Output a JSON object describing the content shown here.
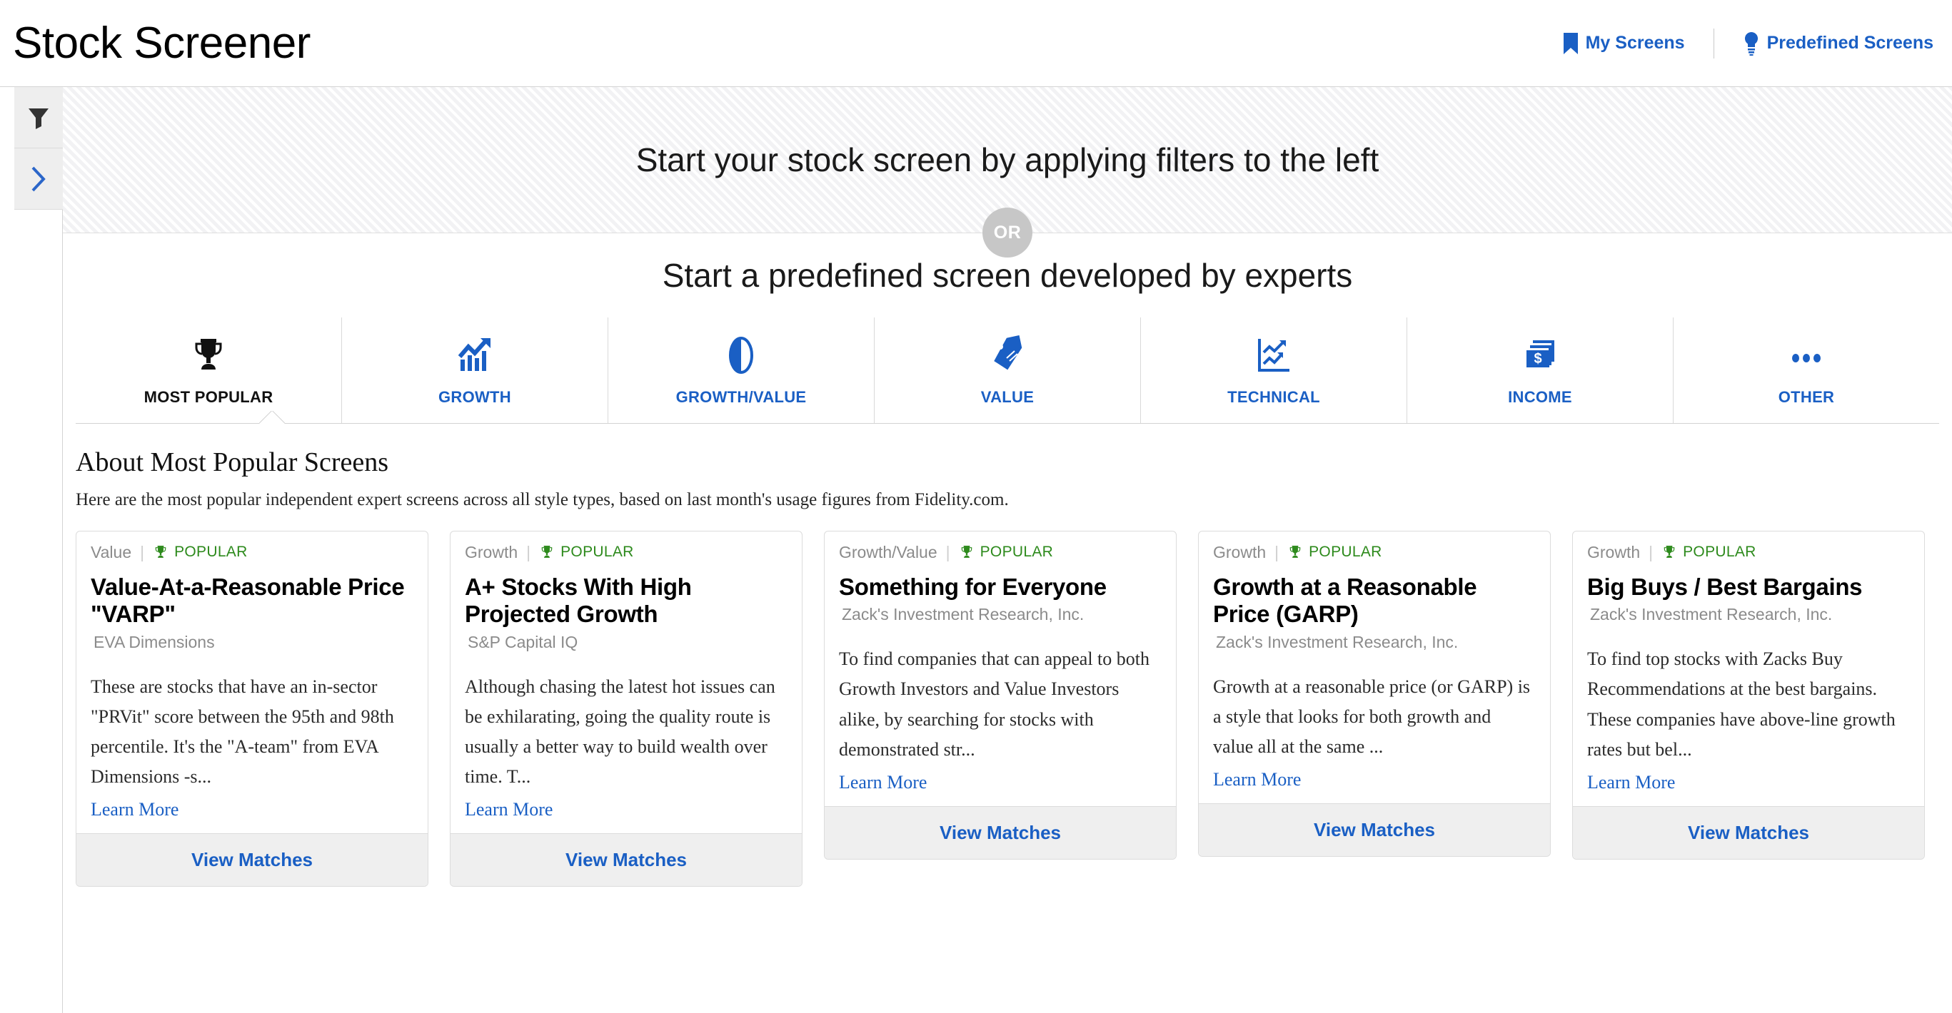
{
  "header": {
    "title": "Stock Screener",
    "links": [
      {
        "label": "My Screens",
        "icon": "bookmark-icon"
      },
      {
        "label": "Predefined Screens",
        "icon": "lightbulb-icon"
      }
    ]
  },
  "left_rail": {
    "buttons": [
      {
        "icon": "filter-funnel-icon"
      },
      {
        "icon": "chevron-right-icon"
      }
    ]
  },
  "hero": {
    "line1": "Start your stock screen by applying filters to the left",
    "or_badge": "OR",
    "line2": "Start a predefined screen developed by experts"
  },
  "tabs": [
    {
      "label": "MOST POPULAR",
      "icon": "trophy-icon",
      "active": true
    },
    {
      "label": "GROWTH",
      "icon": "growth-chart-arrow-icon",
      "active": false
    },
    {
      "label": "GROWTH/VALUE",
      "icon": "half-filled-circle-icon",
      "active": false
    },
    {
      "label": "VALUE",
      "icon": "price-tag-icon",
      "active": false
    },
    {
      "label": "TECHNICAL",
      "icon": "technical-chart-icon",
      "active": false
    },
    {
      "label": "INCOME",
      "icon": "money-stack-icon",
      "active": false
    },
    {
      "label": "OTHER",
      "icon": "ellipsis-icon",
      "active": false
    }
  ],
  "about": {
    "title": "About Most Popular Screens",
    "description": "Here are the most popular independent expert screens across all style types, based on last month's usage figures from Fidelity.com."
  },
  "colors": {
    "link_blue": "#1a5fc4",
    "popular_green": "#2d8a1c",
    "meta_gray": "#8b8b8b",
    "footer_gray": "#efefef"
  },
  "cards": [
    {
      "style": "Value",
      "badge": "POPULAR",
      "badge_icon": "trophy-icon",
      "title": "Value-At-a-Reasonable Price \"VARP\"",
      "provider": "EVA Dimensions",
      "description": "These are stocks that have an in-sector \"PRVit\" score between the 95th and 98th percentile. It's the \"A-team\" from EVA Dimensions -s...",
      "learn_more": "Learn More",
      "action": "View Matches"
    },
    {
      "style": "Growth",
      "badge": "POPULAR",
      "badge_icon": "trophy-icon",
      "title": "A+ Stocks With High Projected Growth",
      "provider": "S&P Capital IQ",
      "description": "Although chasing the latest hot issues can be exhilarating, going the quality route is usually a better way to build wealth over time. T...",
      "learn_more": "Learn More",
      "action": "View Matches"
    },
    {
      "style": "Growth/Value",
      "badge": "POPULAR",
      "badge_icon": "trophy-icon",
      "title": "Something for Everyone",
      "provider": "Zack's Investment Research, Inc.",
      "description": "To find companies that can appeal to both Growth Investors and Value Investors alike, by searching for stocks with demonstrated str...",
      "learn_more": "Learn More",
      "action": "View Matches"
    },
    {
      "style": "Growth",
      "badge": "POPULAR",
      "badge_icon": "trophy-icon",
      "title": "Growth at a Reasonable Price (GARP)",
      "provider": "Zack's Investment Research, Inc.",
      "description": "Growth at a reasonable price (or GARP) is a style that looks for both growth and value all at the same ...",
      "learn_more": "Learn More",
      "action": "View Matches"
    },
    {
      "style": "Growth",
      "badge": "POPULAR",
      "badge_icon": "trophy-icon",
      "title": "Big Buys / Best Bargains",
      "provider": "Zack's Investment Research, Inc.",
      "description": "To find top stocks with Zacks Buy Recommendations at the best bargains. These companies have above-line growth rates but bel...",
      "learn_more": "Learn More",
      "action": "View Matches"
    }
  ]
}
